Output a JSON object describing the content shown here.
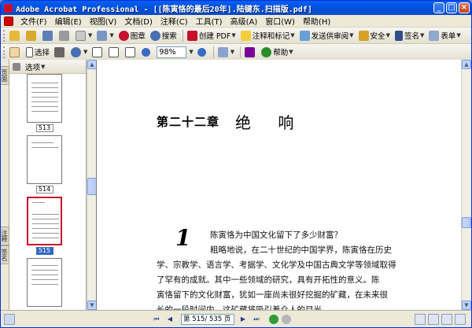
{
  "window": {
    "title": "Adobe Acrobat Professional - [[陈寅恪的最后20年].陆键东.扫描版.pdf]",
    "minimize": "_",
    "maximize": "□",
    "close": "×"
  },
  "menu": {
    "items": [
      "文件(F)",
      "编辑(E)",
      "视图(V)",
      "文档(D)",
      "注释(C)",
      "工具(T)",
      "高级(A)",
      "窗口(W)",
      "帮助(H)"
    ]
  },
  "toolbar1": {
    "organize_label": "图章",
    "search_label": "搜索",
    "create_pdf_label": "创建 PDF",
    "comment_label": "注释和标记",
    "send_review_label": "发送供审阅",
    "secure_label": "安全",
    "sign_label": "签名",
    "forms_label": "表单"
  },
  "toolbar2": {
    "select_label": "选择",
    "zoom_value": "98%",
    "help_label": "帮助"
  },
  "nav_panel": {
    "tab_pages": "页面",
    "tab_comments": "注释",
    "tab_sign": "签名",
    "options_label": "选项",
    "thumbnails": [
      {
        "label": "513"
      },
      {
        "label": "514"
      },
      {
        "label": "515"
      }
    ]
  },
  "document": {
    "chapter_number": "第二十二章",
    "chapter_name": "绝 响",
    "dropcap": "1",
    "lines": [
      "陈寅恪为中国文化留下了多少财富？",
      "粗略地说，在二十世纪的中国学界，陈寅恪在历史",
      "学、宗教学、语言学、考据学、文化学及中国古典文学等领域取得",
      "了罕有的成就。其中一些领域的研究，具有开拓性的意义。陈",
      "寅恪留下的文化财富，犹如一座尚未很好挖掘的矿藏，在未来很",
      "长的一段时间内，这矿藏将吸引着众人的目光。"
    ]
  },
  "statusbar": {
    "page_display": "第 515/ 535 页"
  }
}
